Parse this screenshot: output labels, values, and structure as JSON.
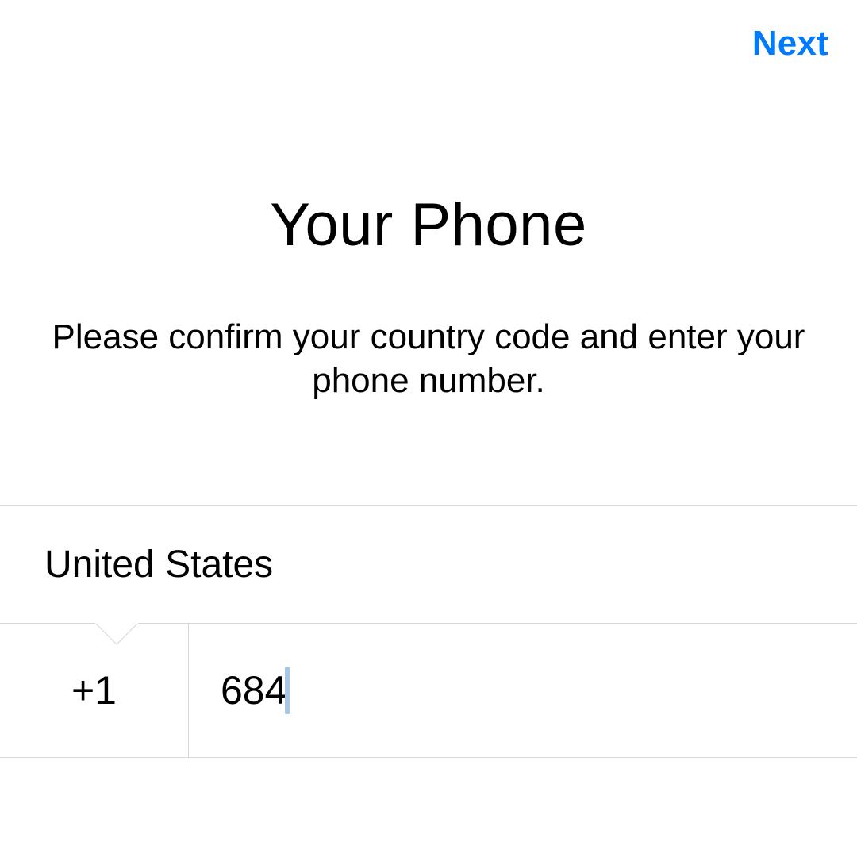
{
  "header": {
    "next_label": "Next"
  },
  "title": "Your Phone",
  "subtitle": "Please confirm your country code and enter your phone number.",
  "country": {
    "name": "United States",
    "code": "+1"
  },
  "phone": {
    "value": "684"
  },
  "colors": {
    "accent": "#007aff",
    "caret": "#a6c8e6",
    "separator": "#d8d8d8"
  }
}
